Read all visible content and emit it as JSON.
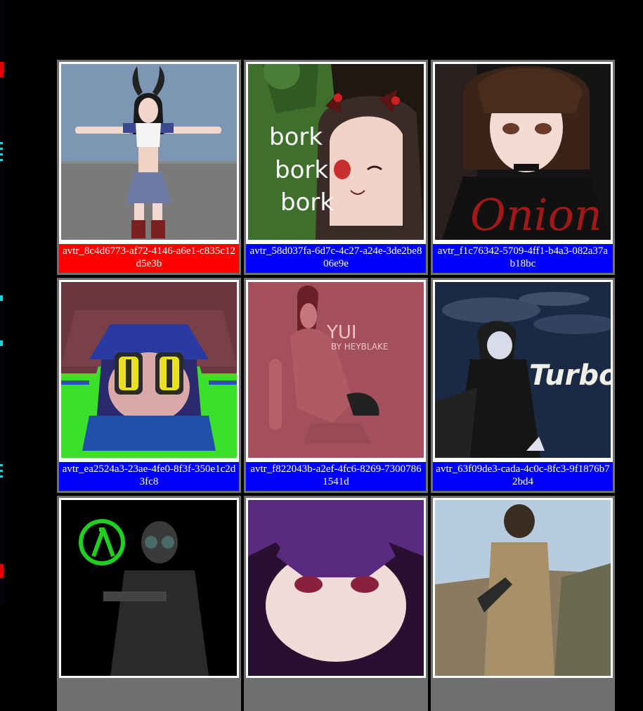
{
  "avatars": [
    {
      "id": "avtr_8c4d6773-af72-4146-a6e1-c835c12d5e3b",
      "selected": true,
      "caption_color": "#ff0000",
      "image": "anime-bunny-ears-girl-tpose"
    },
    {
      "id": "avtr_58d037fa-6d7c-4c27-a24e-3de2be806e9e",
      "selected": false,
      "caption_color": "#0000ff",
      "image": "bork-bork-bork",
      "image_text": [
        "bork",
        "bork",
        "bork"
      ]
    },
    {
      "id": "avtr_f1c76342-5709-4ff1-b4a3-082a37ab18bc",
      "selected": false,
      "caption_color": "#0000ff",
      "image": "onion-girl",
      "image_text": "Onion"
    },
    {
      "id": "avtr_ea2524a3-23ae-4fe0-8f3f-350e1c2d3fc8",
      "selected": false,
      "caption_color": "#0000ff",
      "image": "cat-hat-character"
    },
    {
      "id": "avtr_f822043b-a2ef-4fc6-8269-73007861541d",
      "selected": false,
      "caption_color": "#0000ff",
      "image": "yui-pink",
      "image_text": [
        "YUI",
        "BY HEYBLAKE"
      ]
    },
    {
      "id": "avtr_63f09de3-cada-4c0c-8fc3-9f1876b72bd4",
      "selected": false,
      "caption_color": "#0000ff",
      "image": "turbo-dark",
      "image_text": "Turbo"
    },
    {
      "id": "",
      "selected": false,
      "caption_color": "#0000ff",
      "image": "lambda-gas-mask-soldier"
    },
    {
      "id": "",
      "selected": false,
      "caption_color": "#0000ff",
      "image": "purple-hair-anime-face"
    },
    {
      "id": "",
      "selected": false,
      "caption_color": "#0000ff",
      "image": "desert-soldier"
    }
  ]
}
